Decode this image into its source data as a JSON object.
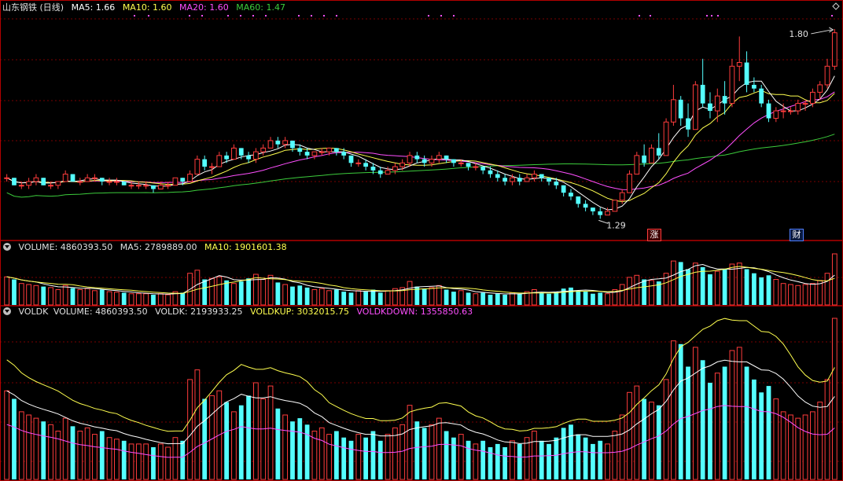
{
  "header": {
    "stock_title": "山东钢铁 (日线)",
    "ma5": "MA5: 1.66",
    "ma10": "MA10: 1.60",
    "ma20": "MA20: 1.60",
    "ma60": "MA60: 1.47"
  },
  "volume_header": {
    "volume": "VOLUME: 4860393.50",
    "ma5": "MA5: 2789889.00",
    "ma10": "MA10: 1901601.38"
  },
  "voldk_header": {
    "name": "VOLDK",
    "volume": "VOLUME: 4860393.50",
    "voldk": "VOLDK: 2193933.25",
    "voldkup": "VOLDKUP: 3032015.75",
    "voldkdown": "VOLDKDOWN: 1355850.63"
  },
  "annotations": {
    "high_label": "1.80",
    "low_label": "1.29",
    "zhang_badge": "涨",
    "cai_badge": "财"
  },
  "colors": {
    "up": "#ff3c3c",
    "down": "#54ffff",
    "ma5": "#ffffff",
    "ma10": "#ffff4f",
    "ma20": "#ff4fff",
    "ma60": "#3ccc3c",
    "grid": "#7a0000",
    "divider": "#b30000"
  },
  "chart_data": {
    "type": "candlestick",
    "price_range": [
      1.24,
      1.84
    ],
    "volume_max": 4860393.5,
    "candles": [
      [
        1.4,
        1.41,
        1.39,
        1.4
      ],
      [
        1.4,
        1.4,
        1.38,
        1.38
      ],
      [
        1.38,
        1.39,
        1.37,
        1.38
      ],
      [
        1.38,
        1.4,
        1.37,
        1.39
      ],
      [
        1.39,
        1.41,
        1.38,
        1.4
      ],
      [
        1.4,
        1.4,
        1.38,
        1.38
      ],
      [
        1.38,
        1.39,
        1.37,
        1.38
      ],
      [
        1.38,
        1.39,
        1.37,
        1.39
      ],
      [
        1.39,
        1.42,
        1.39,
        1.41
      ],
      [
        1.41,
        1.41,
        1.39,
        1.39
      ],
      [
        1.39,
        1.4,
        1.38,
        1.39
      ],
      [
        1.39,
        1.41,
        1.39,
        1.4
      ],
      [
        1.4,
        1.41,
        1.39,
        1.4
      ],
      [
        1.4,
        1.4,
        1.38,
        1.39
      ],
      [
        1.39,
        1.4,
        1.38,
        1.39
      ],
      [
        1.39,
        1.4,
        1.38,
        1.39
      ],
      [
        1.39,
        1.39,
        1.38,
        1.38
      ],
      [
        1.38,
        1.39,
        1.37,
        1.38
      ],
      [
        1.38,
        1.39,
        1.37,
        1.38
      ],
      [
        1.38,
        1.39,
        1.37,
        1.38
      ],
      [
        1.38,
        1.38,
        1.36,
        1.37
      ],
      [
        1.37,
        1.39,
        1.37,
        1.38
      ],
      [
        1.38,
        1.39,
        1.37,
        1.38
      ],
      [
        1.38,
        1.4,
        1.38,
        1.4
      ],
      [
        1.4,
        1.4,
        1.38,
        1.39
      ],
      [
        1.39,
        1.42,
        1.39,
        1.41
      ],
      [
        1.41,
        1.46,
        1.41,
        1.45
      ],
      [
        1.45,
        1.46,
        1.42,
        1.43
      ],
      [
        1.43,
        1.44,
        1.41,
        1.43
      ],
      [
        1.43,
        1.47,
        1.43,
        1.46
      ],
      [
        1.46,
        1.47,
        1.44,
        1.45
      ],
      [
        1.45,
        1.49,
        1.45,
        1.48
      ],
      [
        1.48,
        1.48,
        1.45,
        1.46
      ],
      [
        1.46,
        1.47,
        1.44,
        1.45
      ],
      [
        1.45,
        1.48,
        1.44,
        1.47
      ],
      [
        1.47,
        1.49,
        1.46,
        1.48
      ],
      [
        1.48,
        1.51,
        1.48,
        1.5
      ],
      [
        1.5,
        1.51,
        1.48,
        1.49
      ],
      [
        1.49,
        1.51,
        1.48,
        1.5
      ],
      [
        1.5,
        1.5,
        1.47,
        1.48
      ],
      [
        1.48,
        1.49,
        1.46,
        1.47
      ],
      [
        1.47,
        1.48,
        1.45,
        1.46
      ],
      [
        1.46,
        1.47,
        1.45,
        1.47
      ],
      [
        1.47,
        1.48,
        1.46,
        1.47
      ],
      [
        1.47,
        1.48,
        1.46,
        1.48
      ],
      [
        1.48,
        1.48,
        1.46,
        1.47
      ],
      [
        1.47,
        1.48,
        1.45,
        1.46
      ],
      [
        1.46,
        1.46,
        1.43,
        1.44
      ],
      [
        1.44,
        1.45,
        1.43,
        1.44
      ],
      [
        1.44,
        1.45,
        1.42,
        1.43
      ],
      [
        1.43,
        1.44,
        1.41,
        1.42
      ],
      [
        1.42,
        1.43,
        1.4,
        1.41
      ],
      [
        1.41,
        1.43,
        1.41,
        1.42
      ],
      [
        1.42,
        1.44,
        1.41,
        1.43
      ],
      [
        1.43,
        1.45,
        1.42,
        1.44
      ],
      [
        1.44,
        1.47,
        1.43,
        1.46
      ],
      [
        1.46,
        1.47,
        1.44,
        1.45
      ],
      [
        1.45,
        1.46,
        1.43,
        1.44
      ],
      [
        1.44,
        1.46,
        1.43,
        1.45
      ],
      [
        1.45,
        1.47,
        1.44,
        1.46
      ],
      [
        1.46,
        1.46,
        1.44,
        1.45
      ],
      [
        1.45,
        1.45,
        1.43,
        1.44
      ],
      [
        1.44,
        1.45,
        1.43,
        1.44
      ],
      [
        1.44,
        1.44,
        1.42,
        1.43
      ],
      [
        1.43,
        1.44,
        1.42,
        1.43
      ],
      [
        1.43,
        1.43,
        1.41,
        1.42
      ],
      [
        1.42,
        1.43,
        1.4,
        1.41
      ],
      [
        1.41,
        1.42,
        1.39,
        1.4
      ],
      [
        1.4,
        1.41,
        1.38,
        1.39
      ],
      [
        1.39,
        1.41,
        1.38,
        1.4
      ],
      [
        1.4,
        1.41,
        1.38,
        1.39
      ],
      [
        1.39,
        1.41,
        1.39,
        1.4
      ],
      [
        1.4,
        1.42,
        1.39,
        1.41
      ],
      [
        1.41,
        1.41,
        1.39,
        1.4
      ],
      [
        1.4,
        1.4,
        1.38,
        1.39
      ],
      [
        1.39,
        1.4,
        1.37,
        1.38
      ],
      [
        1.38,
        1.38,
        1.35,
        1.36
      ],
      [
        1.36,
        1.37,
        1.34,
        1.35
      ],
      [
        1.35,
        1.35,
        1.32,
        1.33
      ],
      [
        1.33,
        1.34,
        1.31,
        1.32
      ],
      [
        1.32,
        1.32,
        1.3,
        1.31
      ],
      [
        1.31,
        1.32,
        1.29,
        1.3
      ],
      [
        1.3,
        1.32,
        1.3,
        1.31
      ],
      [
        1.31,
        1.34,
        1.31,
        1.34
      ],
      [
        1.34,
        1.37,
        1.33,
        1.36
      ],
      [
        1.36,
        1.42,
        1.36,
        1.41
      ],
      [
        1.41,
        1.47,
        1.41,
        1.46
      ],
      [
        1.46,
        1.49,
        1.43,
        1.44
      ],
      [
        1.44,
        1.49,
        1.44,
        1.48
      ],
      [
        1.48,
        1.52,
        1.45,
        1.46
      ],
      [
        1.46,
        1.56,
        1.46,
        1.55
      ],
      [
        1.55,
        1.65,
        1.54,
        1.61
      ],
      [
        1.61,
        1.62,
        1.54,
        1.56
      ],
      [
        1.56,
        1.6,
        1.51,
        1.53
      ],
      [
        1.53,
        1.66,
        1.53,
        1.65
      ],
      [
        1.65,
        1.72,
        1.59,
        1.6
      ],
      [
        1.6,
        1.63,
        1.56,
        1.58
      ],
      [
        1.58,
        1.64,
        1.55,
        1.62
      ],
      [
        1.62,
        1.66,
        1.57,
        1.6
      ],
      [
        1.6,
        1.72,
        1.59,
        1.7
      ],
      [
        1.7,
        1.78,
        1.66,
        1.71
      ],
      [
        1.71,
        1.74,
        1.63,
        1.65
      ],
      [
        1.65,
        1.67,
        1.63,
        1.64
      ],
      [
        1.64,
        1.65,
        1.59,
        1.6
      ],
      [
        1.6,
        1.61,
        1.55,
        1.56
      ],
      [
        1.56,
        1.59,
        1.55,
        1.58
      ],
      [
        1.58,
        1.6,
        1.56,
        1.58
      ],
      [
        1.58,
        1.59,
        1.57,
        1.58
      ],
      [
        1.58,
        1.61,
        1.57,
        1.6
      ],
      [
        1.6,
        1.61,
        1.58,
        1.6
      ],
      [
        1.6,
        1.64,
        1.59,
        1.63
      ],
      [
        1.63,
        1.66,
        1.61,
        1.65
      ],
      [
        1.65,
        1.72,
        1.64,
        1.7
      ],
      [
        1.7,
        1.8,
        1.69,
        1.79
      ]
    ],
    "volumes": [
      0.55,
      0.5,
      0.42,
      0.4,
      0.38,
      0.36,
      0.34,
      0.3,
      0.38,
      0.33,
      0.3,
      0.32,
      0.28,
      0.3,
      0.26,
      0.25,
      0.24,
      0.22,
      0.22,
      0.22,
      0.2,
      0.22,
      0.2,
      0.26,
      0.24,
      0.62,
      0.68,
      0.5,
      0.52,
      0.55,
      0.48,
      0.42,
      0.46,
      0.52,
      0.6,
      0.5,
      0.58,
      0.44,
      0.4,
      0.36,
      0.38,
      0.34,
      0.3,
      0.32,
      0.28,
      0.3,
      0.26,
      0.24,
      0.28,
      0.26,
      0.3,
      0.24,
      0.28,
      0.32,
      0.34,
      0.46,
      0.36,
      0.32,
      0.34,
      0.38,
      0.3,
      0.26,
      0.28,
      0.24,
      0.22,
      0.24,
      0.2,
      0.22,
      0.2,
      0.24,
      0.22,
      0.26,
      0.3,
      0.24,
      0.22,
      0.26,
      0.32,
      0.34,
      0.28,
      0.26,
      0.22,
      0.24,
      0.22,
      0.3,
      0.4,
      0.54,
      0.58,
      0.5,
      0.48,
      0.46,
      0.62,
      0.86,
      0.84,
      0.7,
      0.82,
      0.74,
      0.6,
      0.66,
      0.7,
      0.8,
      0.82,
      0.7,
      0.62,
      0.54,
      0.58,
      0.5,
      0.42,
      0.4,
      0.38,
      0.4,
      0.42,
      0.48,
      0.62,
      1.0
    ]
  }
}
